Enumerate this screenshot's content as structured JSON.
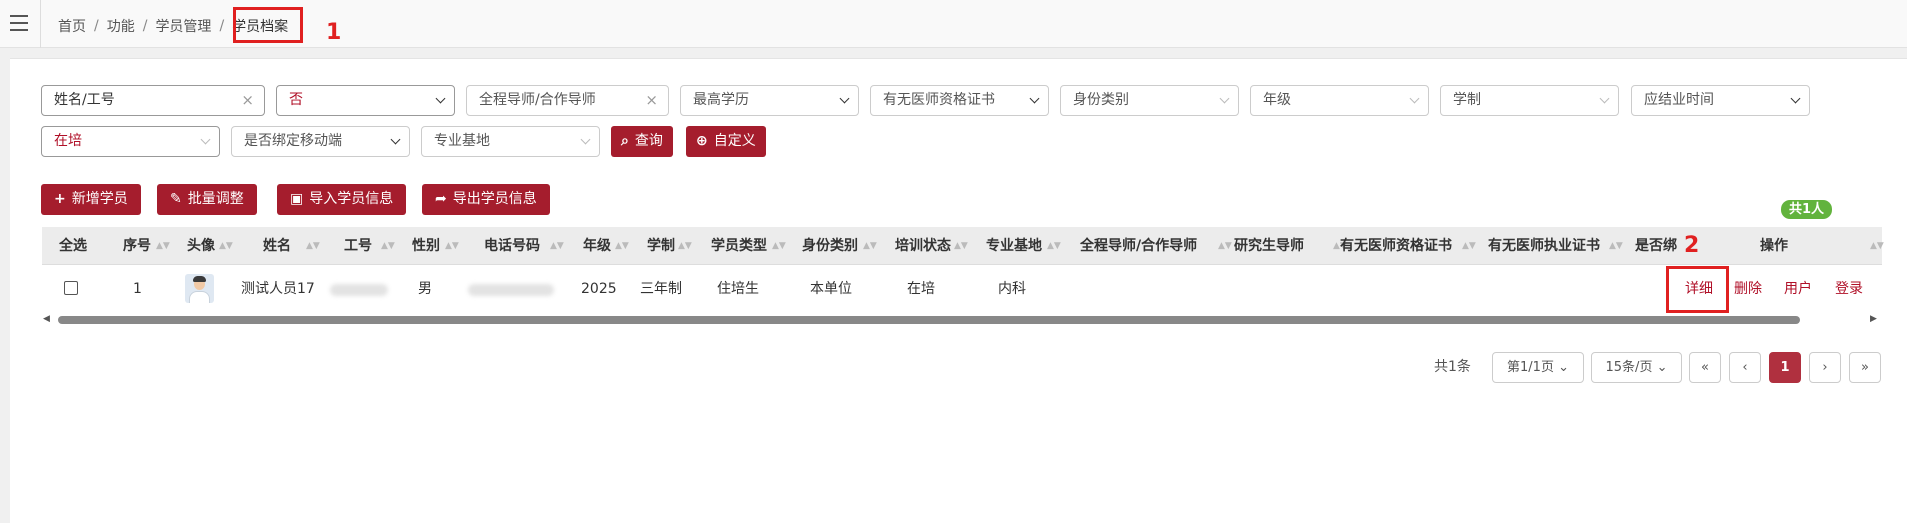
{
  "breadcrumb": {
    "home": "首页",
    "func": "功能",
    "mgmt": "学员管理",
    "current": "学员档案",
    "sep": "/"
  },
  "annotations": {
    "n1": "1",
    "n2": "2"
  },
  "filters": {
    "name": "姓名/工号",
    "bound_status": "否",
    "mentor_placeholder": "全程导师/合作导师",
    "edu": "最高学历",
    "physician_cert": "有无医师资格证书",
    "identity": "身份类别",
    "grade": "年级",
    "program": "学制",
    "grad_time": "应结业时间",
    "train_status": "在培",
    "mobile_bound": "是否绑定移动端",
    "base": "专业基地",
    "clear": "×"
  },
  "buttons": {
    "query": "查询",
    "custom": "自定义",
    "add": "新增学员",
    "batch": "批量调整",
    "import": "导入学员信息",
    "export": "导出学员信息"
  },
  "total_badge": "共1人",
  "table": {
    "headers": [
      "全选",
      "序号",
      "头像",
      "姓名",
      "工号",
      "性别",
      "电话号码",
      "年级",
      "学制",
      "学员类型",
      "身份类别",
      "培训状态",
      "专业基地",
      "全程导师/合作导师",
      "研究生导师",
      "有无医师资格证书",
      "有无医师执业证书",
      "是否绑",
      "操作"
    ],
    "row": {
      "index": "1",
      "name": "测试人员17",
      "gender": "男",
      "grade": "2025",
      "program": "三年制",
      "type": "住培生",
      "identity": "本单位",
      "status": "在培",
      "base": "内科"
    },
    "actions": {
      "detail": "详细",
      "delete": "删除",
      "user": "用户",
      "login": "登录"
    }
  },
  "pager": {
    "total": "共1条",
    "page_select": "第1/1页",
    "size_select": "15条/页",
    "first": "«",
    "prev": "‹",
    "current": "1",
    "next": "›",
    "last": "»"
  },
  "icons": {
    "sort": "▲▼",
    "left_arrow": "◀",
    "right_arrow": "▶"
  },
  "colors": {
    "accent": "#a51d2d",
    "badge": "#62b33d",
    "highlight": "#e02020"
  }
}
